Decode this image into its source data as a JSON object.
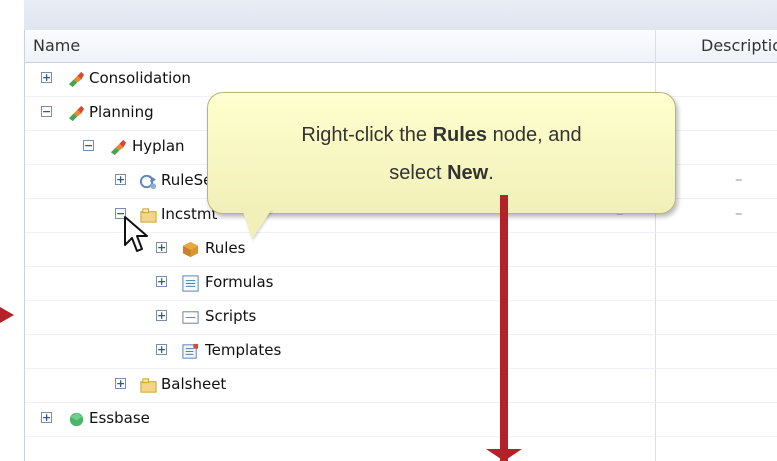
{
  "header": {
    "name_label": "Name",
    "description_label": "Description"
  },
  "tree": {
    "consolidation": "Consolidation",
    "planning": "Planning",
    "hyplan": "Hyplan",
    "rulesets": "RuleSets",
    "incstmt": "Incstmt",
    "rules": "Rules",
    "formulas": "Formulas",
    "scripts": "Scripts",
    "templates": "Templates",
    "balsheet": "Balsheet",
    "essbase": "Essbase"
  },
  "placeholders": {
    "dash": "–"
  },
  "callout": {
    "line1_prefix": "Right-click the ",
    "line1_strong": "Rules",
    "line1_suffix": " node, and",
    "line2_prefix": "select ",
    "line2_strong": "New",
    "line2_suffix": "."
  },
  "colors": {
    "arrow": "#b22228",
    "callout_fill": "#ffffcf",
    "tree_blue": "#315a92"
  },
  "icons": {
    "expand": "plus-box-icon",
    "collapse": "minus-box-icon",
    "consolidation": "app-group-icon",
    "planning": "app-group-icon",
    "hyplan": "app-group-icon",
    "rulesets": "rulesets-icon",
    "incstmt": "folder-icon",
    "rules": "rules-icon",
    "formulas": "formulas-icon",
    "scripts": "scripts-icon",
    "templates": "templates-icon",
    "balsheet": "folder-icon",
    "essbase": "cube-icon"
  }
}
